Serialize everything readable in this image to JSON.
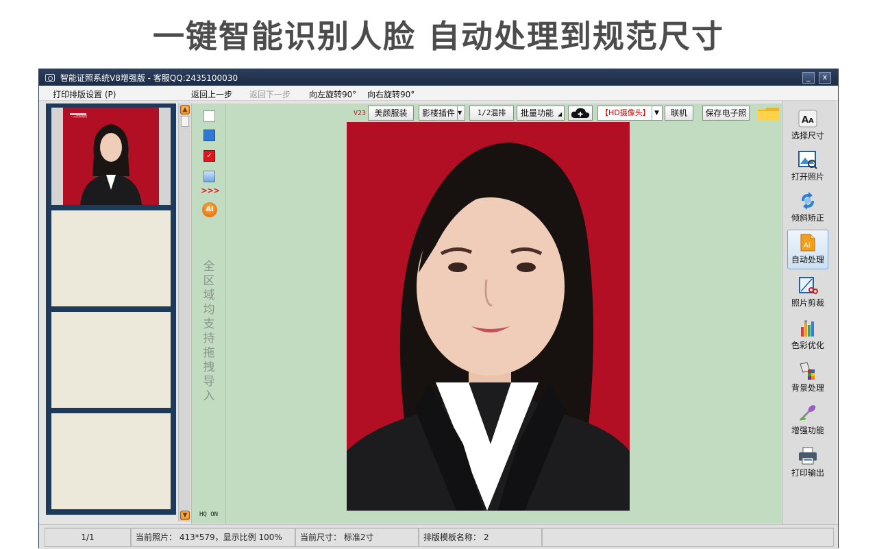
{
  "headline": "一键智能识别人脸  自动处理到规范尺寸",
  "window": {
    "title": "智能证照系统V8增强版 - 客服QQ:2435100030",
    "minimize": "_",
    "close": "x"
  },
  "menu": {
    "print_layout": "打印排版设置 (P)",
    "undo": "返回上一步",
    "redo": "返回下一步",
    "rotate_left": "向左旋转90°",
    "rotate_right": "向右旋转90°"
  },
  "toolbar": {
    "version": "V23",
    "beauty": "美颜服装",
    "plugin": "影楼插件",
    "half_mix": "1/2混排",
    "batch": "批量功能",
    "camera": "【HD摄像头】",
    "online": "联机",
    "save_electronic": "保存电子照"
  },
  "left_tools": {
    "drag_hint": "全区域均支持拖拽导入",
    "hq": "HQ ON",
    "arrows": ">>>"
  },
  "thumbnail": {
    "logo_text": "一元贺照相馆"
  },
  "right_panel": [
    {
      "icon": "font-size-icon",
      "label": "选择尺寸"
    },
    {
      "icon": "open-photo-icon",
      "label": "打开照片"
    },
    {
      "icon": "rotate-correct-icon",
      "label": "倾斜矫正"
    },
    {
      "icon": "ai-auto-icon",
      "label": "自动处理"
    },
    {
      "icon": "crop-icon",
      "label": "照片剪裁"
    },
    {
      "icon": "color-chart-icon",
      "label": "色彩优化"
    },
    {
      "icon": "background-icon",
      "label": "背景处理"
    },
    {
      "icon": "enhance-icon",
      "label": "增强功能"
    },
    {
      "icon": "printer-icon",
      "label": "打印输出"
    }
  ],
  "status": {
    "page": "1/1",
    "photo_info": "当前照片：   413*579，显示比例 100%",
    "size_info": "当前尺寸：    标准2寸",
    "template_info": "排版模板名称：  2"
  },
  "colors": {
    "photo_bg": "#b20f25",
    "canvas_bg": "#c1dcc0",
    "titlebar": "#1d2c45",
    "thumb_border": "#1e3a5a"
  }
}
